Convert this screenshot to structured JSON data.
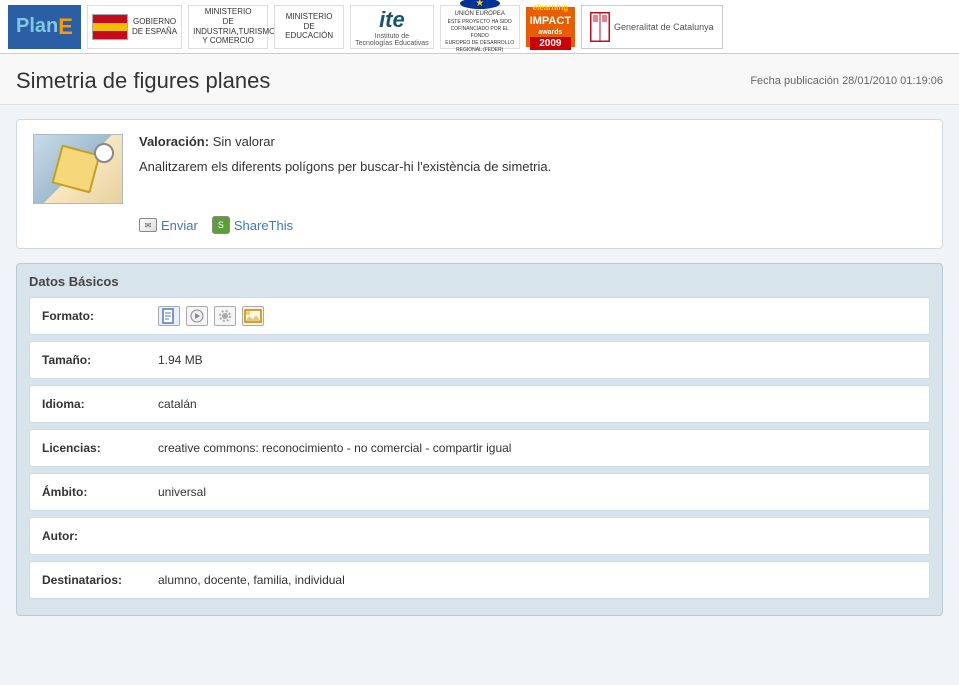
{
  "header": {
    "logos": [
      {
        "id": "plane",
        "type": "plane-logo"
      },
      {
        "id": "spain",
        "type": "spain-flag",
        "text": "GOBIERNO\nDE ESPAÑA"
      },
      {
        "id": "ministerio-turismo",
        "type": "text-logo",
        "text": "MINISTERIO\nDE INDUSTRIA,TURISMO\nY COMERCIO"
      },
      {
        "id": "ministerio-educacion",
        "type": "text-logo",
        "text": "MINISTERIO\nDE EDUCACIÓN"
      },
      {
        "id": "ite",
        "type": "ite-logo",
        "text": "Instituto de\nTecnologías Educativas"
      },
      {
        "id": "eu",
        "type": "eu-logo",
        "text": "UNIÓN EUROPEA"
      },
      {
        "id": "awards",
        "type": "awards-logo",
        "text": "elearning\nIMPACT\nawards\n2009"
      },
      {
        "id": "generalitat",
        "type": "generalitat-logo",
        "text": "Generalitat de Catalunya"
      }
    ]
  },
  "page": {
    "title": "Simetria de figures planes",
    "pub_date_label": "Fecha publicación",
    "pub_date": "28/01/2010 01:19:06"
  },
  "content": {
    "valoracion_label": "Valoración:",
    "valoracion_value": "Sin valorar",
    "description": "Analitzarem els diferents polígons per buscar-hi l'existència de simetria.",
    "actions": {
      "send_label": "Enviar",
      "sharethis_label": "ShareThis"
    }
  },
  "datos": {
    "section_title": "Datos Básicos",
    "rows": [
      {
        "label": "Formato:",
        "value": "",
        "type": "icons",
        "icons": [
          "doc",
          "audio",
          "gear",
          "img"
        ]
      },
      {
        "label": "Tamaño:",
        "value": "1.94 MB",
        "type": "text"
      },
      {
        "label": "Idioma:",
        "value": "catalán",
        "type": "text"
      },
      {
        "label": "Licencias:",
        "value": "creative commons: reconocimiento - no comercial - compartir igual",
        "type": "text"
      },
      {
        "label": "Ámbito:",
        "value": "universal",
        "type": "text"
      },
      {
        "label": "Autor:",
        "value": "",
        "type": "text"
      },
      {
        "label": "Destinatarios:",
        "value": "alumno, docente, familia, individual",
        "type": "text"
      }
    ]
  }
}
